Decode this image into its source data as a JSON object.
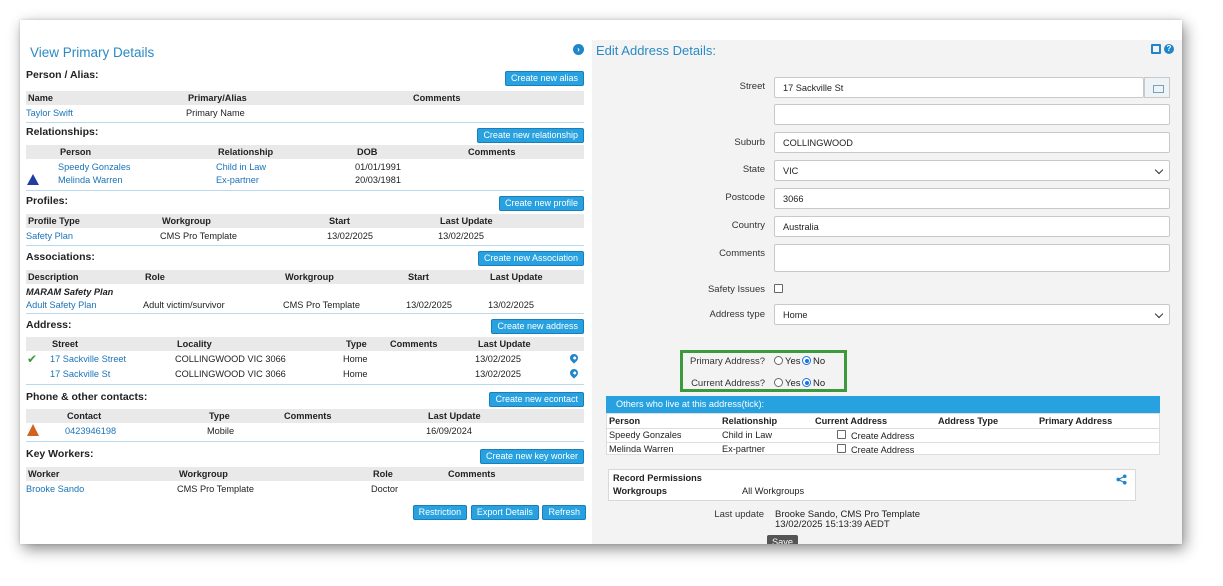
{
  "view": {
    "title": "View Primary Details",
    "nav_icon": "chevron-right-circle-icon"
  },
  "alias": {
    "title": "Person / Alias:",
    "button": "Create new alias",
    "headers": [
      "Name",
      "Primary/Alias",
      "Comments"
    ],
    "rows": [
      {
        "name": "Taylor Swift",
        "primary": "Primary Name",
        "comments": ""
      }
    ]
  },
  "relationships": {
    "title": "Relationships:",
    "button": "Create new relationship",
    "headers": [
      "Person",
      "Relationship",
      "DOB",
      "Comments"
    ],
    "rows": [
      {
        "person": "Speedy Gonzales",
        "relationship": "Child in Law",
        "dob": "01/01/1991",
        "comments": ""
      },
      {
        "person": "Melinda Warren",
        "relationship": "Ex-partner",
        "dob": "20/03/1981",
        "comments": "",
        "icon": "warning-blue-icon"
      }
    ]
  },
  "profiles": {
    "title": "Profiles:",
    "button": "Create new profile",
    "headers": [
      "Profile Type",
      "Workgroup",
      "Start",
      "Last Update"
    ],
    "rows": [
      {
        "type": "Safety Plan",
        "workgroup": "CMS Pro Template",
        "start": "13/02/2025",
        "last_update": "13/02/2025"
      }
    ]
  },
  "associations": {
    "title": "Associations:",
    "button": "Create new Association",
    "headers": [
      "Description",
      "Role",
      "Workgroup",
      "Start",
      "Last Update"
    ],
    "group": "MARAM Safety Plan",
    "rows": [
      {
        "description": "Adult Safety Plan",
        "role": "Adult victim/survivor",
        "workgroup": "CMS Pro Template",
        "start": "13/02/2025",
        "last_update": "13/02/2025"
      }
    ]
  },
  "address": {
    "title": "Address:",
    "button": "Create new address",
    "headers": [
      "Street",
      "Locality",
      "Type",
      "Comments",
      "Last Update"
    ],
    "rows": [
      {
        "street": "17 Sackville Street",
        "locality": "COLLINGWOOD VIC 3066",
        "type": "Home",
        "comments": "",
        "last_update": "13/02/2025",
        "status_icon": "checkmark-icon"
      },
      {
        "street": "17 Sackville St",
        "locality": "COLLINGWOOD VIC 3066",
        "type": "Home",
        "comments": "",
        "last_update": "13/02/2025"
      }
    ]
  },
  "contacts": {
    "title": "Phone & other contacts:",
    "button": "Create new econtact",
    "headers": [
      "Contact",
      "Type",
      "Comments",
      "Last Update"
    ],
    "rows": [
      {
        "contact": "0423946198",
        "type": "Mobile",
        "comments": "",
        "last_update": "16/09/2024",
        "icon": "warning-orange-icon"
      }
    ]
  },
  "keyworkers": {
    "title": "Key Workers:",
    "button": "Create new key worker",
    "headers": [
      "Worker",
      "Workgroup",
      "Role",
      "Comments"
    ],
    "rows": [
      {
        "worker": "Brooke Sando",
        "workgroup": "CMS Pro Template",
        "role": "Doctor",
        "comments": ""
      }
    ]
  },
  "actions": {
    "restriction": "Restriction",
    "export": "Export Details",
    "refresh": "Refresh"
  },
  "edit": {
    "title": "Edit Address Details:",
    "labels": {
      "street": "Street",
      "suburb": "Suburb",
      "state": "State",
      "postcode": "Postcode",
      "country": "Country",
      "comments": "Comments",
      "safety": "Safety Issues",
      "address_type": "Address type",
      "primary": "Primary Address?",
      "current": "Current Address?",
      "yes": "Yes",
      "no": "No"
    },
    "values": {
      "street1": "17 Sackville St",
      "street2": "",
      "suburb": "COLLINGWOOD",
      "state": "VIC",
      "postcode": "3066",
      "country": "Australia",
      "comments": "",
      "address_type": "Home",
      "safety_issues": false,
      "primary_address": "No",
      "current_address": "No"
    },
    "others": {
      "title": "Others who live at this address(tick):",
      "headers": [
        "Person",
        "Relationship",
        "Current Address",
        "Address Type",
        "Primary Address"
      ],
      "rows": [
        {
          "person": "Speedy Gonzales",
          "relationship": "Child in Law",
          "create": "Create Address"
        },
        {
          "person": "Melinda Warren",
          "relationship": "Ex-partner",
          "create": "Create Address"
        }
      ]
    },
    "permissions": {
      "title": "Record Permissions",
      "workgroups_label": "Workgroups",
      "workgroups_value": "All Workgroups"
    },
    "last_update_label": "Last update",
    "last_update_by": "Brooke Sando, CMS Pro Template",
    "last_update_time": "13/02/2025 15:13:39 AEDT",
    "save": "Save"
  }
}
